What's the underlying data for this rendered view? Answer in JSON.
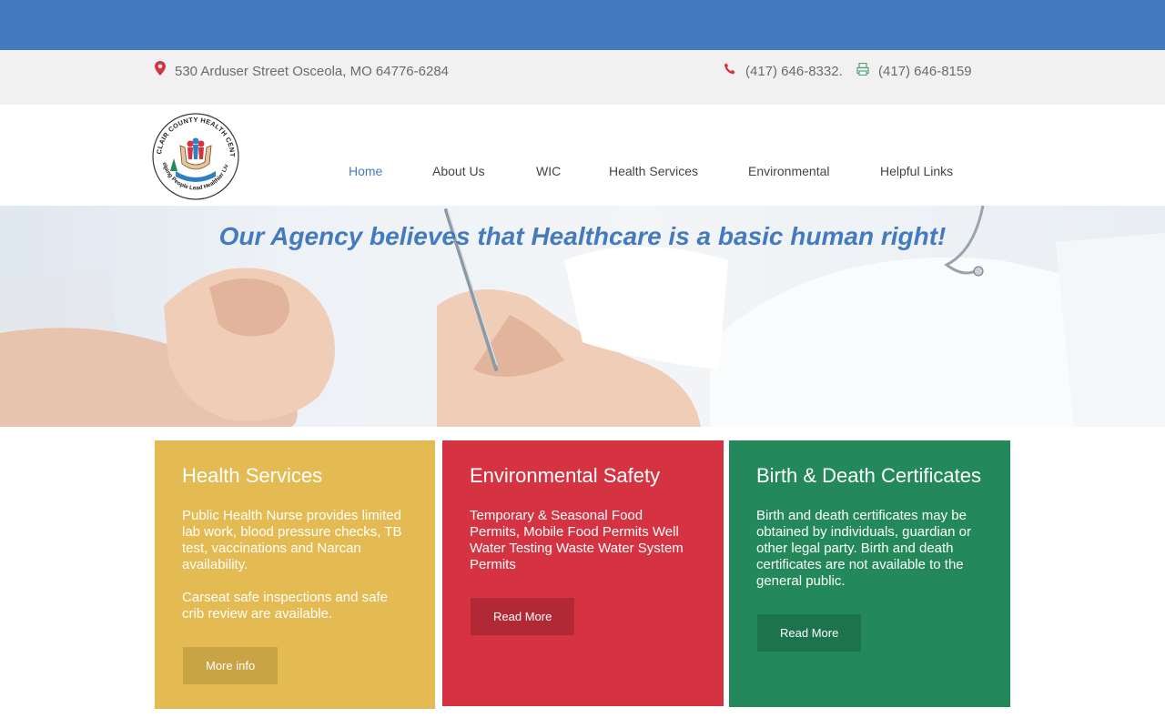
{
  "contact": {
    "address": "530 Arduser Street Osceola, MO 64776-6284",
    "phone": "(417) 646-8332.",
    "fax": "(417) 646-8159",
    "icons": [
      "map-pin-icon",
      "phone-icon",
      "fax-icon"
    ]
  },
  "logo": {
    "arc_text": "ST. CLAIR COUNTY HEALTH CENTER",
    "tagline": "Helping People Lead Healthier Lives"
  },
  "nav": {
    "items": [
      {
        "label": "Home"
      },
      {
        "label": "About Us"
      },
      {
        "label": "WIC"
      },
      {
        "label": "Health Services"
      },
      {
        "label": "Environmental"
      },
      {
        "label": "Helpful Links"
      }
    ],
    "active": "Home"
  },
  "hero": {
    "title": "Our Agency believes that Healthcare is a basic human right!"
  },
  "cards": [
    {
      "title": "Health Services",
      "paragraphs": [
        "Public Health Nurse provides limited lab work, blood pressure checks, TB test, vaccinations and Narcan availability.",
        "Carseat safe inspections and safe crib review are available."
      ],
      "button": "More info"
    },
    {
      "title": "Environmental Safety",
      "paragraphs": [
        "Temporary & Seasonal Food Permits, Mobile Food Permits Well Water Testing Waste Water System Permits"
      ],
      "button": "Read More"
    },
    {
      "title": "Birth & Death Certificates",
      "paragraphs": [
        "Birth and death certificates may be obtained by individuals, guardian or other legal party. Birth and death certificates are not available to the general public."
      ],
      "button": "Read More"
    }
  ],
  "colors": {
    "brand_blue": "#447bbf",
    "card_yellow": "#e3bb52",
    "card_red": "#d53341",
    "card_green": "#23885a",
    "info_bar": "#f1f1f1"
  }
}
